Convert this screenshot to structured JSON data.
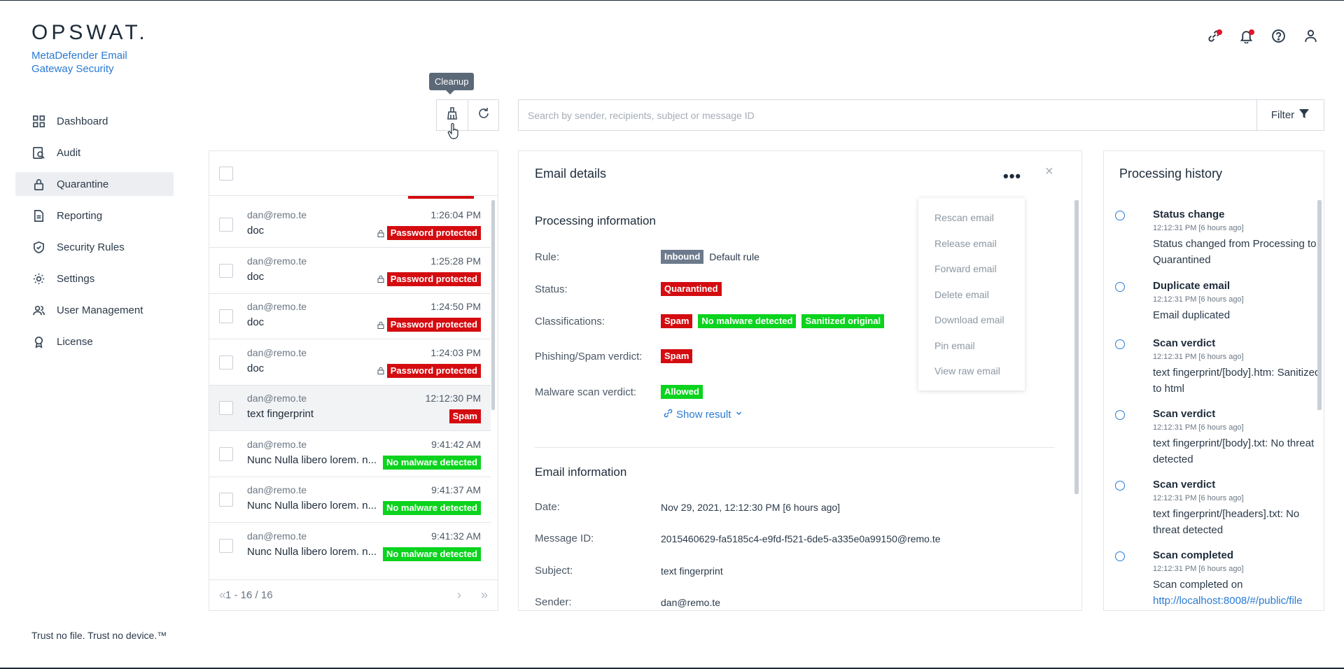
{
  "brand": {
    "logo": "OPSWAT.",
    "product": "MetaDefender Email Gateway Security"
  },
  "nav": [
    {
      "label": "Dashboard",
      "icon": "dashboard-icon"
    },
    {
      "label": "Audit",
      "icon": "audit-icon"
    },
    {
      "label": "Quarantine",
      "icon": "lock-icon",
      "active": true
    },
    {
      "label": "Reporting",
      "icon": "document-icon"
    },
    {
      "label": "Security Rules",
      "icon": "shield-check-icon"
    },
    {
      "label": "Settings",
      "icon": "gear-icon"
    },
    {
      "label": "User Management",
      "icon": "users-icon"
    },
    {
      "label": "License",
      "icon": "badge-icon"
    }
  ],
  "footer": "Trust no file. Trust no device.™",
  "toolbar": {
    "tooltip": "Cleanup"
  },
  "search": {
    "placeholder": "Search by sender, recipients, subject or message ID",
    "filter_label": "Filter"
  },
  "emails": [
    {
      "from": "dan@remo.te",
      "time": "1:26:04 PM",
      "subject": "doc",
      "badge": "Password protected",
      "badge_color": "#d40c10",
      "locked": true
    },
    {
      "from": "dan@remo.te",
      "time": "1:25:28 PM",
      "subject": "doc",
      "badge": "Password protected",
      "badge_color": "#d40c10",
      "locked": true
    },
    {
      "from": "dan@remo.te",
      "time": "1:24:50 PM",
      "subject": "doc",
      "badge": "Password protected",
      "badge_color": "#d40c10",
      "locked": true
    },
    {
      "from": "dan@remo.te",
      "time": "1:24:03 PM",
      "subject": "doc",
      "badge": "Password protected",
      "badge_color": "#d40c10",
      "locked": true
    },
    {
      "from": "dan@remo.te",
      "time": "12:12:30 PM",
      "subject": "text fingerprint",
      "badge": "Spam",
      "badge_color": "#d40c10",
      "locked": false,
      "selected": true
    },
    {
      "from": "dan@remo.te",
      "time": "9:41:42 AM",
      "subject": "Nunc Nulla libero lorem. n...",
      "badge": "No malware detected",
      "badge_color": "#0bd31e",
      "locked": false
    },
    {
      "from": "dan@remo.te",
      "time": "9:41:37 AM",
      "subject": "Nunc Nulla libero lorem. n...",
      "badge": "No malware detected",
      "badge_color": "#0bd31e",
      "locked": false
    },
    {
      "from": "dan@remo.te",
      "time": "9:41:32 AM",
      "subject": "Nunc Nulla libero lorem. n...",
      "badge": "No malware detected",
      "badge_color": "#0bd31e",
      "locked": false
    }
  ],
  "pager": {
    "label": "1 - 16 / 16"
  },
  "details": {
    "title": "Email details",
    "more": "•••",
    "close": "×",
    "processing_title": "Processing information",
    "rule_label": "Rule:",
    "rule_badge": "Inbound",
    "rule_value": "Default rule",
    "status_label": "Status:",
    "status_badge": "Quarantined",
    "class_label": "Classifications:",
    "class_badges": [
      "Spam",
      "No malware detected",
      "Sanitized original"
    ],
    "phish_label": "Phishing/Spam verdict:",
    "phish_badge": "Spam",
    "malware_label": "Malware scan verdict:",
    "malware_badge": "Allowed",
    "show_result": "Show result",
    "email_info_title": "Email information",
    "date_label": "Date:",
    "date_value": "Nov 29, 2021, 12:12:30 PM [6 hours ago]",
    "msgid_label": "Message ID:",
    "msgid_value": "2015460629-fa5185c4-e9fd-f521-6de5-a335e0a99150@remo.te",
    "subject_label": "Subject:",
    "subject_value": "text fingerprint",
    "sender_label": "Sender:",
    "sender_value": "dan@remo.te"
  },
  "menu": [
    "Rescan email",
    "Release email",
    "Forward email",
    "Delete email",
    "Download email",
    "Pin email",
    "View raw email"
  ],
  "history": {
    "title": "Processing history",
    "events": [
      {
        "title": "Status change",
        "time": "12:12:31 PM [6 hours ago]",
        "desc": "Status changed from Processing to Quarantined"
      },
      {
        "title": "Duplicate email",
        "time": "12:12:31 PM [6 hours ago]",
        "desc": "Email duplicated"
      },
      {
        "title": "Scan verdict",
        "time": "12:12:31 PM [6 hours ago]",
        "desc": "text fingerprint/[body].htm: Sanitized to html"
      },
      {
        "title": "Scan verdict",
        "time": "12:12:31 PM [6 hours ago]",
        "desc": "text fingerprint/[body].txt: No threat detected"
      },
      {
        "title": "Scan verdict",
        "time": "12:12:31 PM [6 hours ago]",
        "desc": "text fingerprint/[headers].txt: No threat detected"
      },
      {
        "title": "Scan completed",
        "time": "12:12:31 PM [6 hours ago]",
        "desc": "Scan completed on",
        "link": "http://localhost:8008/#/public/file"
      }
    ]
  }
}
